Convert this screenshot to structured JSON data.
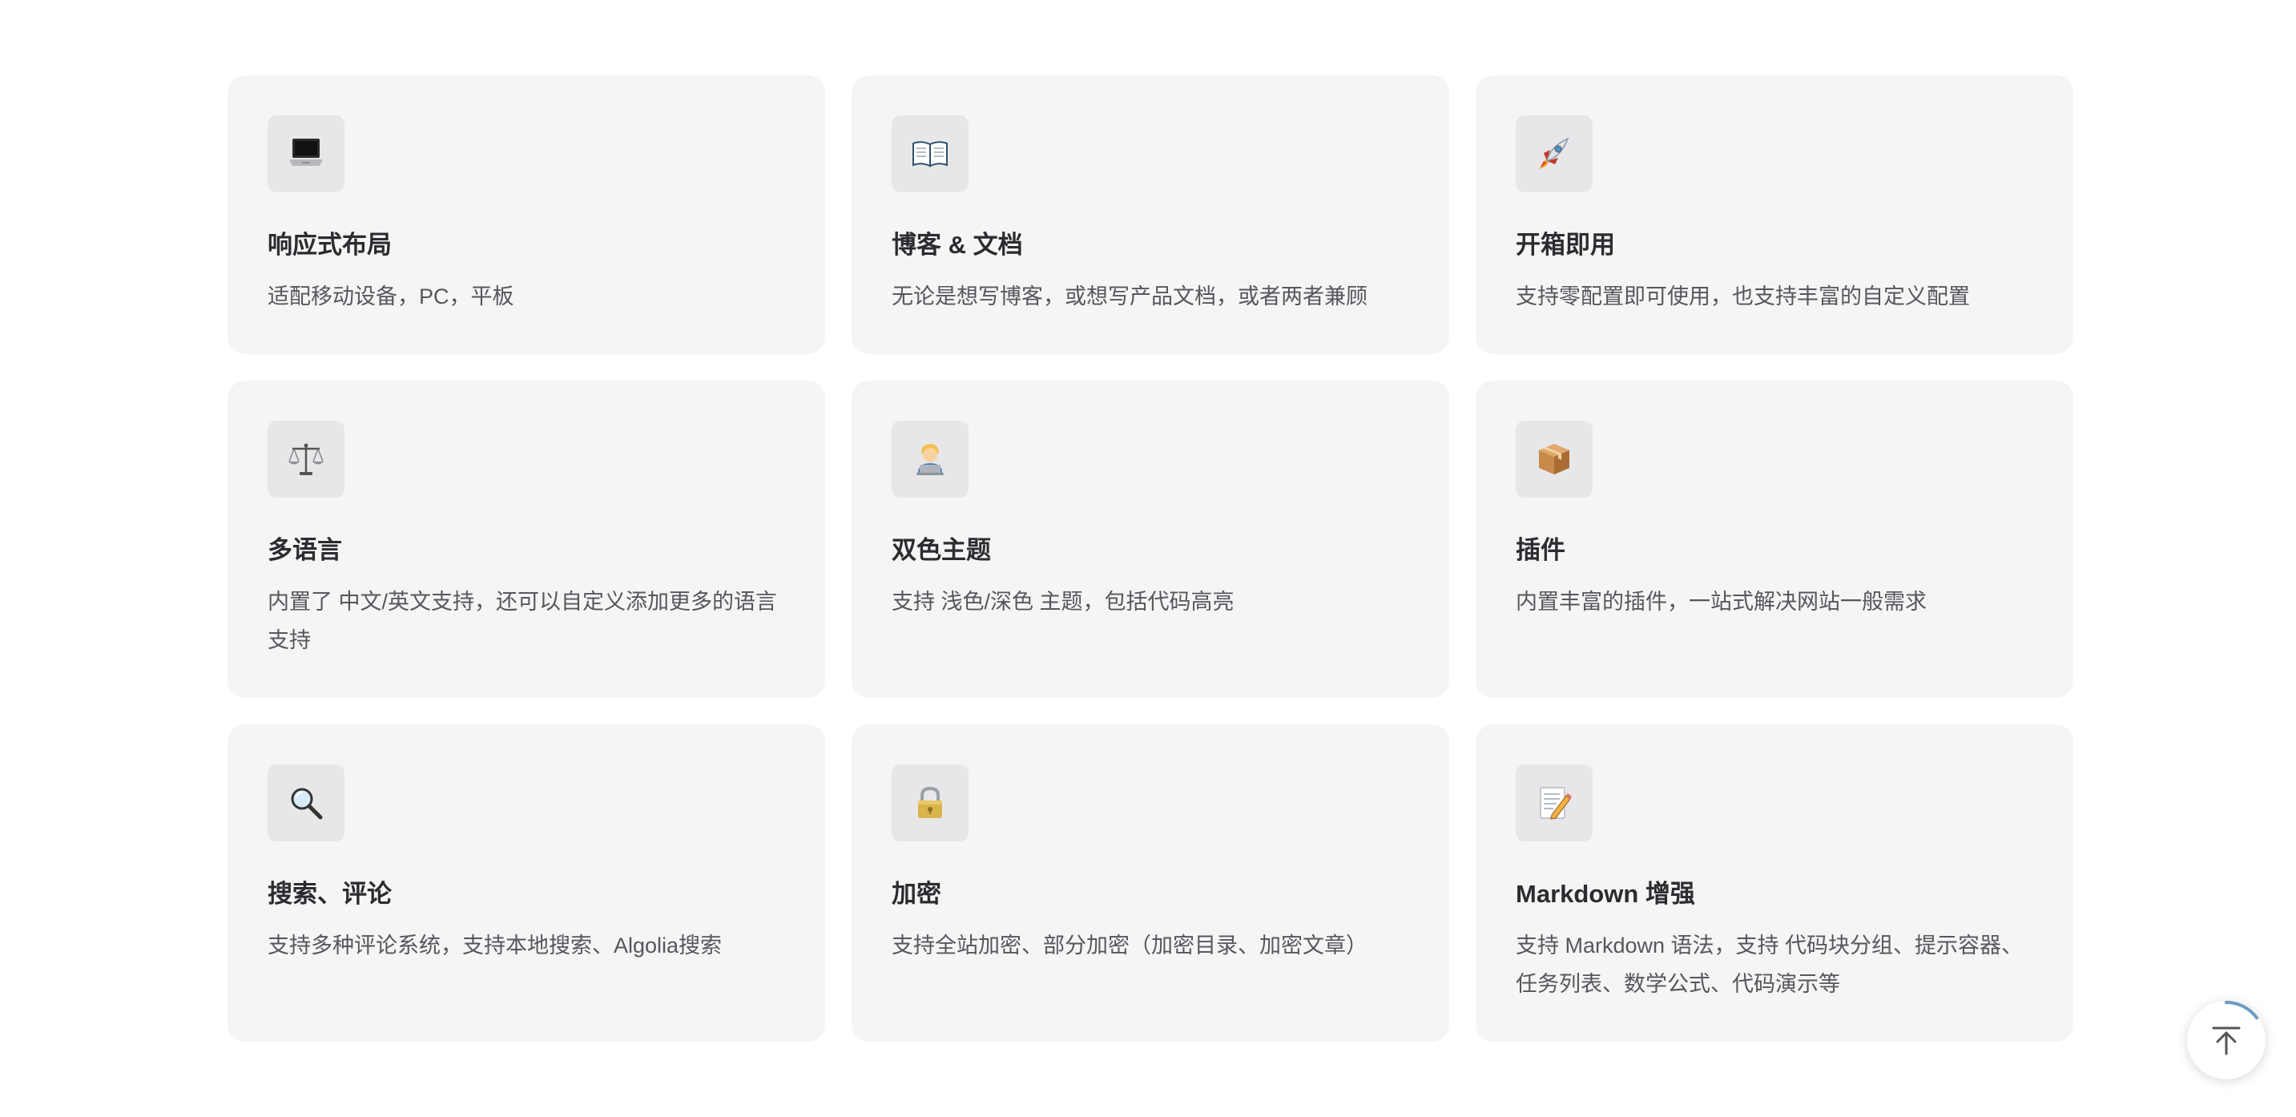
{
  "features": [
    {
      "icon": "laptop-icon",
      "title": "响应式布局",
      "desc": "适配移动设备，PC，平板"
    },
    {
      "icon": "open-book-icon",
      "title": "博客 & 文档",
      "desc": "无论是想写博客，或想写产品文档，或者两者兼顾"
    },
    {
      "icon": "rocket-icon",
      "title": "开箱即用",
      "desc": "支持零配置即可使用，也支持丰富的自定义配置"
    },
    {
      "icon": "balance-scale-icon",
      "title": "多语言",
      "desc": "内置了 中文/英文支持，还可以自定义添加更多的语言支持"
    },
    {
      "icon": "technologist-icon",
      "title": "双色主题",
      "desc": "支持 浅色/深色 主题，包括代码高亮"
    },
    {
      "icon": "package-icon",
      "title": "插件",
      "desc": "内置丰富的插件，一站式解决网站一般需求"
    },
    {
      "icon": "magnifier-icon",
      "title": "搜索、评论",
      "desc": "支持多种评论系统，支持本地搜索、Algolia搜索"
    },
    {
      "icon": "lock-icon",
      "title": "加密",
      "desc": "支持全站加密、部分加密（加密目录、加密文章）"
    },
    {
      "icon": "memo-icon",
      "title": "Markdown 增强",
      "desc": "支持 Markdown 语法，支持 代码块分组、提示容器、任务列表、数学公式、代码演示等"
    }
  ],
  "back_to_top": {
    "icon": "arrow-up-to-top-icon",
    "progress": 0.15
  },
  "colors": {
    "card_bg": "#f5f5f6",
    "icon_bg": "#e7e7ea",
    "progress_ring": "#6b9bc0"
  }
}
